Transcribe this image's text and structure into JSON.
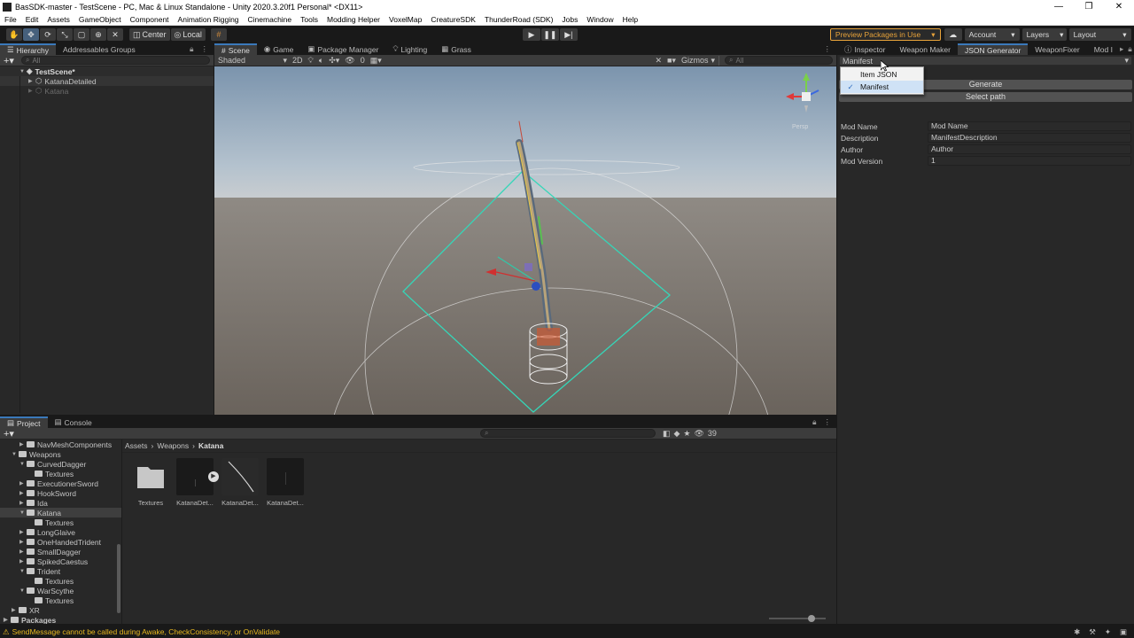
{
  "window": {
    "title": "BasSDK-master - TestScene - PC, Mac & Linux Standalone - Unity 2020.3.20f1 Personal* <DX11>",
    "buttons": [
      "—",
      "❐",
      "✕"
    ]
  },
  "menu": [
    "File",
    "Edit",
    "Assets",
    "GameObject",
    "Component",
    "Animation Rigging",
    "Cinemachine",
    "Tools",
    "Modding Helper",
    "VoxelMap",
    "CreatureSDK",
    "ThunderRoad (SDK)",
    "Jobs",
    "Window",
    "Help"
  ],
  "toolbar": {
    "pivot_center": "Center",
    "pivot_local": "Local",
    "preview_packages": "Preview Packages in Use",
    "account": "Account",
    "layers": "Layers",
    "layout": "Layout"
  },
  "hierarchy": {
    "tabs": [
      "Hierarchy",
      "Addressables Groups"
    ],
    "search_placeholder": "All",
    "scene": "TestScene*",
    "items": [
      "KatanaDetailed",
      "Katana"
    ]
  },
  "scene_view": {
    "tabs": [
      "Scene",
      "Game",
      "Package Manager",
      "Lighting",
      "Grass"
    ],
    "shading": "Shaded",
    "mode_2d": "2D",
    "hidden_count": "0",
    "gizmos": "Gizmos",
    "search_placeholder": "All",
    "persp": "Persp"
  },
  "inspector": {
    "tabs": [
      "Inspector",
      "Weapon Maker",
      "JSON Generator",
      "WeaponFixer",
      "Mod I"
    ],
    "selector_value": "Manifest",
    "dropdown_options": [
      {
        "label": "Item JSON",
        "checked": false
      },
      {
        "label": "Manifest",
        "checked": true
      }
    ],
    "generate_label": "Generate",
    "select_path_label": "Select path",
    "fields": [
      {
        "label": "Mod Name",
        "value": "Mod Name"
      },
      {
        "label": "Description",
        "value": "ManifestDescription"
      },
      {
        "label": "Author",
        "value": "Author"
      },
      {
        "label": "Mod Version",
        "value": "1"
      }
    ]
  },
  "project": {
    "tabs": [
      "Project",
      "Console"
    ],
    "tree": [
      {
        "label": "NavMeshComponents",
        "indent": 2,
        "arrow": "▶"
      },
      {
        "label": "Weapons",
        "indent": 1,
        "arrow": "▼"
      },
      {
        "label": "CurvedDagger",
        "indent": 2,
        "arrow": "▼"
      },
      {
        "label": "Textures",
        "indent": 3,
        "arrow": ""
      },
      {
        "label": "ExecutionerSword",
        "indent": 2,
        "arrow": "▶"
      },
      {
        "label": "HookSword",
        "indent": 2,
        "arrow": "▶"
      },
      {
        "label": "Ida",
        "indent": 2,
        "arrow": "▶"
      },
      {
        "label": "Katana",
        "indent": 2,
        "arrow": "▼",
        "selected": true
      },
      {
        "label": "Textures",
        "indent": 3,
        "arrow": ""
      },
      {
        "label": "LongGlaive",
        "indent": 2,
        "arrow": "▶"
      },
      {
        "label": "OneHandedTrident",
        "indent": 2,
        "arrow": "▶"
      },
      {
        "label": "SmallDagger",
        "indent": 2,
        "arrow": "▶"
      },
      {
        "label": "SpikedCaestus",
        "indent": 2,
        "arrow": "▶"
      },
      {
        "label": "Trident",
        "indent": 2,
        "arrow": "▼"
      },
      {
        "label": "Textures",
        "indent": 3,
        "arrow": ""
      },
      {
        "label": "WarScythe",
        "indent": 2,
        "arrow": "▼"
      },
      {
        "label": "Textures",
        "indent": 3,
        "arrow": ""
      },
      {
        "label": "XR",
        "indent": 1,
        "arrow": "▶"
      },
      {
        "label": "Packages",
        "indent": 0,
        "arrow": "▶"
      }
    ],
    "breadcrumb": [
      "Assets",
      "Weapons",
      "Katana"
    ],
    "count": "39",
    "assets": [
      "Textures",
      "KatanaDet...",
      "KatanaDet...",
      "KatanaDet..."
    ]
  },
  "status": {
    "message": "SendMessage cannot be called during Awake, CheckConsistency, or OnValidate"
  }
}
